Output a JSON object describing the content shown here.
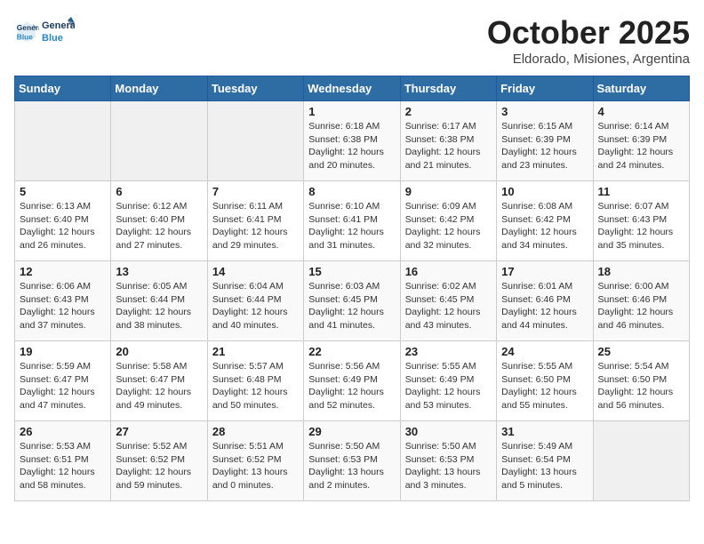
{
  "header": {
    "logo_line1": "General",
    "logo_line2": "Blue",
    "month": "October 2025",
    "location": "Eldorado, Misiones, Argentina"
  },
  "weekdays": [
    "Sunday",
    "Monday",
    "Tuesday",
    "Wednesday",
    "Thursday",
    "Friday",
    "Saturday"
  ],
  "weeks": [
    [
      {
        "day": "",
        "info": ""
      },
      {
        "day": "",
        "info": ""
      },
      {
        "day": "",
        "info": ""
      },
      {
        "day": "1",
        "info": "Sunrise: 6:18 AM\nSunset: 6:38 PM\nDaylight: 12 hours\nand 20 minutes."
      },
      {
        "day": "2",
        "info": "Sunrise: 6:17 AM\nSunset: 6:38 PM\nDaylight: 12 hours\nand 21 minutes."
      },
      {
        "day": "3",
        "info": "Sunrise: 6:15 AM\nSunset: 6:39 PM\nDaylight: 12 hours\nand 23 minutes."
      },
      {
        "day": "4",
        "info": "Sunrise: 6:14 AM\nSunset: 6:39 PM\nDaylight: 12 hours\nand 24 minutes."
      }
    ],
    [
      {
        "day": "5",
        "info": "Sunrise: 6:13 AM\nSunset: 6:40 PM\nDaylight: 12 hours\nand 26 minutes."
      },
      {
        "day": "6",
        "info": "Sunrise: 6:12 AM\nSunset: 6:40 PM\nDaylight: 12 hours\nand 27 minutes."
      },
      {
        "day": "7",
        "info": "Sunrise: 6:11 AM\nSunset: 6:41 PM\nDaylight: 12 hours\nand 29 minutes."
      },
      {
        "day": "8",
        "info": "Sunrise: 6:10 AM\nSunset: 6:41 PM\nDaylight: 12 hours\nand 31 minutes."
      },
      {
        "day": "9",
        "info": "Sunrise: 6:09 AM\nSunset: 6:42 PM\nDaylight: 12 hours\nand 32 minutes."
      },
      {
        "day": "10",
        "info": "Sunrise: 6:08 AM\nSunset: 6:42 PM\nDaylight: 12 hours\nand 34 minutes."
      },
      {
        "day": "11",
        "info": "Sunrise: 6:07 AM\nSunset: 6:43 PM\nDaylight: 12 hours\nand 35 minutes."
      }
    ],
    [
      {
        "day": "12",
        "info": "Sunrise: 6:06 AM\nSunset: 6:43 PM\nDaylight: 12 hours\nand 37 minutes."
      },
      {
        "day": "13",
        "info": "Sunrise: 6:05 AM\nSunset: 6:44 PM\nDaylight: 12 hours\nand 38 minutes."
      },
      {
        "day": "14",
        "info": "Sunrise: 6:04 AM\nSunset: 6:44 PM\nDaylight: 12 hours\nand 40 minutes."
      },
      {
        "day": "15",
        "info": "Sunrise: 6:03 AM\nSunset: 6:45 PM\nDaylight: 12 hours\nand 41 minutes."
      },
      {
        "day": "16",
        "info": "Sunrise: 6:02 AM\nSunset: 6:45 PM\nDaylight: 12 hours\nand 43 minutes."
      },
      {
        "day": "17",
        "info": "Sunrise: 6:01 AM\nSunset: 6:46 PM\nDaylight: 12 hours\nand 44 minutes."
      },
      {
        "day": "18",
        "info": "Sunrise: 6:00 AM\nSunset: 6:46 PM\nDaylight: 12 hours\nand 46 minutes."
      }
    ],
    [
      {
        "day": "19",
        "info": "Sunrise: 5:59 AM\nSunset: 6:47 PM\nDaylight: 12 hours\nand 47 minutes."
      },
      {
        "day": "20",
        "info": "Sunrise: 5:58 AM\nSunset: 6:47 PM\nDaylight: 12 hours\nand 49 minutes."
      },
      {
        "day": "21",
        "info": "Sunrise: 5:57 AM\nSunset: 6:48 PM\nDaylight: 12 hours\nand 50 minutes."
      },
      {
        "day": "22",
        "info": "Sunrise: 5:56 AM\nSunset: 6:49 PM\nDaylight: 12 hours\nand 52 minutes."
      },
      {
        "day": "23",
        "info": "Sunrise: 5:55 AM\nSunset: 6:49 PM\nDaylight: 12 hours\nand 53 minutes."
      },
      {
        "day": "24",
        "info": "Sunrise: 5:55 AM\nSunset: 6:50 PM\nDaylight: 12 hours\nand 55 minutes."
      },
      {
        "day": "25",
        "info": "Sunrise: 5:54 AM\nSunset: 6:50 PM\nDaylight: 12 hours\nand 56 minutes."
      }
    ],
    [
      {
        "day": "26",
        "info": "Sunrise: 5:53 AM\nSunset: 6:51 PM\nDaylight: 12 hours\nand 58 minutes."
      },
      {
        "day": "27",
        "info": "Sunrise: 5:52 AM\nSunset: 6:52 PM\nDaylight: 12 hours\nand 59 minutes."
      },
      {
        "day": "28",
        "info": "Sunrise: 5:51 AM\nSunset: 6:52 PM\nDaylight: 13 hours\nand 0 minutes."
      },
      {
        "day": "29",
        "info": "Sunrise: 5:50 AM\nSunset: 6:53 PM\nDaylight: 13 hours\nand 2 minutes."
      },
      {
        "day": "30",
        "info": "Sunrise: 5:50 AM\nSunset: 6:53 PM\nDaylight: 13 hours\nand 3 minutes."
      },
      {
        "day": "31",
        "info": "Sunrise: 5:49 AM\nSunset: 6:54 PM\nDaylight: 13 hours\nand 5 minutes."
      },
      {
        "day": "",
        "info": ""
      }
    ]
  ]
}
